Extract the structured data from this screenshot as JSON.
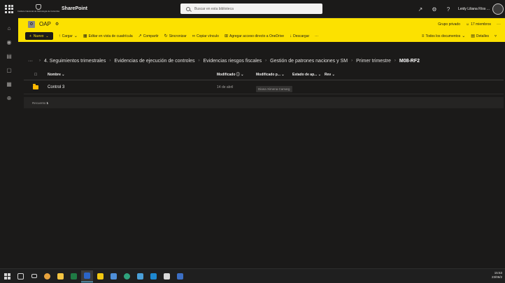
{
  "suite": {
    "org_logo_text": "Instituto Nacional de Metrología de Colombia",
    "app_name": "SharePoint",
    "search_placeholder": "Buscar en esta biblioteca",
    "user_name": "Leidy Liliana Ríos ..."
  },
  "site": {
    "logo_letter": "O",
    "name": "OAP",
    "privacy": "Grupo privado",
    "members": "17 miembros",
    "more": "···"
  },
  "commands": {
    "new": "Nuevo",
    "upload": "Cargar",
    "grid_edit": "Editar en vista de cuadrícula",
    "share": "Compartir",
    "sync": "Sincronizar",
    "copy_link": "Copiar vínculo",
    "onedrive_shortcut": "Agregar acceso directo a OneDrive",
    "download": "Descargar",
    "more": "···",
    "view": "Todos los documentos",
    "details": "Detalles"
  },
  "breadcrumb": {
    "items": [
      "4. Seguimientos trimestrales",
      "Evidencias de ejecución de controles",
      "Evidencias riesgos fiscales",
      "Gestión de patrones naciones y SM",
      "Primer trimestre"
    ],
    "current": "M08-RF2"
  },
  "list": {
    "columns": {
      "name": "Nombre",
      "modified": "Modificado",
      "modified_by": "Modificado p...",
      "state": "Estado de ap...",
      "rev": "Rev"
    },
    "rows": [
      {
        "name": "Control 3",
        "modified": "14 de abril",
        "modified_by": "Diana Ximena Camarg"
      }
    ],
    "footer_label": "Recuento",
    "footer_count": "1"
  },
  "taskbar": {
    "time": "15:53",
    "date": "23/06/2"
  }
}
